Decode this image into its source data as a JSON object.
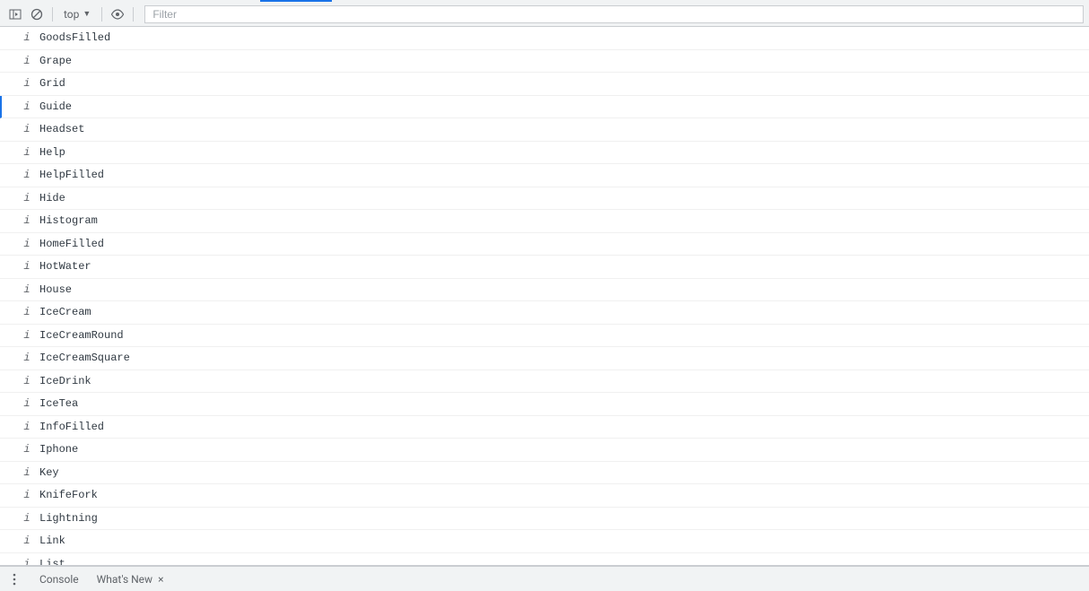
{
  "toolbar": {
    "context": "top",
    "filter_placeholder": "Filter"
  },
  "log": {
    "level_char": "i",
    "selected_index": 3,
    "items": [
      "GoodsFilled",
      "Grape",
      "Grid",
      "Guide",
      "Headset",
      "Help",
      "HelpFilled",
      "Hide",
      "Histogram",
      "HomeFilled",
      "HotWater",
      "House",
      "IceCream",
      "IceCreamRound",
      "IceCreamSquare",
      "IceDrink",
      "IceTea",
      "InfoFilled",
      "Iphone",
      "Key",
      "KnifeFork",
      "Lightning",
      "Link",
      "List"
    ]
  },
  "drawer": {
    "tabs": [
      {
        "label": "Console",
        "closeable": false
      },
      {
        "label": "What's New",
        "closeable": true
      }
    ]
  }
}
